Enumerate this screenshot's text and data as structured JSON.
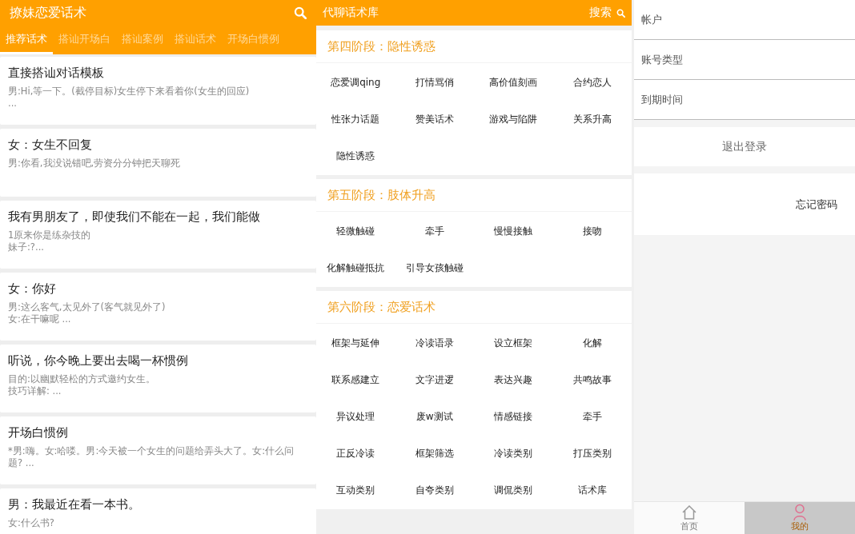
{
  "left": {
    "title": "撩妹恋爱话术",
    "tabs": [
      {
        "label": "推荐话术",
        "selected": true
      },
      {
        "label": "搭讪开场白",
        "selected": false
      },
      {
        "label": "搭讪案例",
        "selected": false
      },
      {
        "label": "搭讪话术",
        "selected": false
      },
      {
        "label": "开场白惯例",
        "selected": false
      }
    ],
    "cards": [
      {
        "title": "直接搭讪对话模板",
        "lines": [
          "男:Hi,等一下。(截停目标)女生停下来看着你(女生的回应)",
          "..."
        ]
      },
      {
        "title": "女：女生不回复",
        "lines": [
          "男:你看,我没说错吧,劳资分分钟把天聊死"
        ]
      },
      {
        "title": "我有男朋友了，即使我们不能在一起，我们能做",
        "lines": [
          "1原来你是练杂技的",
          "妹子:?..."
        ]
      },
      {
        "title": "女：你好",
        "lines": [
          "男:这么客气,太见外了(客气就见外了)",
          "女:在干嘛呢 ..."
        ]
      },
      {
        "title": "听说，你今晚上要出去喝一杯惯例",
        "lines": [
          "目的:以幽默轻松的方式邀约女生。",
          "技巧详解: ..."
        ]
      },
      {
        "title": "开场白惯例",
        "lines": [
          "*男:嗨。女:哈喽。男:今天被一个女生的问题给弄头大了。女:什么问题? ..."
        ]
      },
      {
        "title": "男：我最近在看一本书。",
        "lines": [
          "女:什么书?"
        ]
      }
    ]
  },
  "middle": {
    "title": "代聊话术库",
    "search_label": "搜索",
    "sections": [
      {
        "heading": "第四阶段：隐性诱惑",
        "items": [
          "恋爱调qing",
          "打情骂俏",
          "高价值刻画",
          "合约恋人",
          "性张力话题",
          "赞美话术",
          "游戏与陷阱",
          "关系升高",
          "隐性诱惑"
        ]
      },
      {
        "heading": "第五阶段：肢体升高",
        "items": [
          "轻微触碰",
          "牵手",
          "慢慢接触",
          "接吻",
          "化解触碰抵抗",
          "引导女孩触碰"
        ]
      },
      {
        "heading": "第六阶段：恋爱话术",
        "items": [
          "框架与延伸",
          "冷读语录",
          "设立框架",
          "化解",
          "联系感建立",
          "文字进逻",
          "表达兴趣",
          "共鸣故事",
          "异议处理",
          "废w测试",
          "情感链接",
          "牵手",
          "正反冷读",
          "框架筛选",
          "冷读类别",
          "打压类别",
          "互动类别",
          "自夸类别",
          "调侃类别",
          "话术库"
        ]
      }
    ]
  },
  "right": {
    "fields": [
      {
        "label": "帐户"
      },
      {
        "label": "账号类型"
      },
      {
        "label": "到期时间"
      }
    ],
    "logout": "退出登录",
    "forgot": "忘记密码",
    "nav": [
      {
        "label": "首页",
        "kind": "home",
        "selected": false
      },
      {
        "label": "我的",
        "kind": "person",
        "selected": true
      }
    ]
  }
}
